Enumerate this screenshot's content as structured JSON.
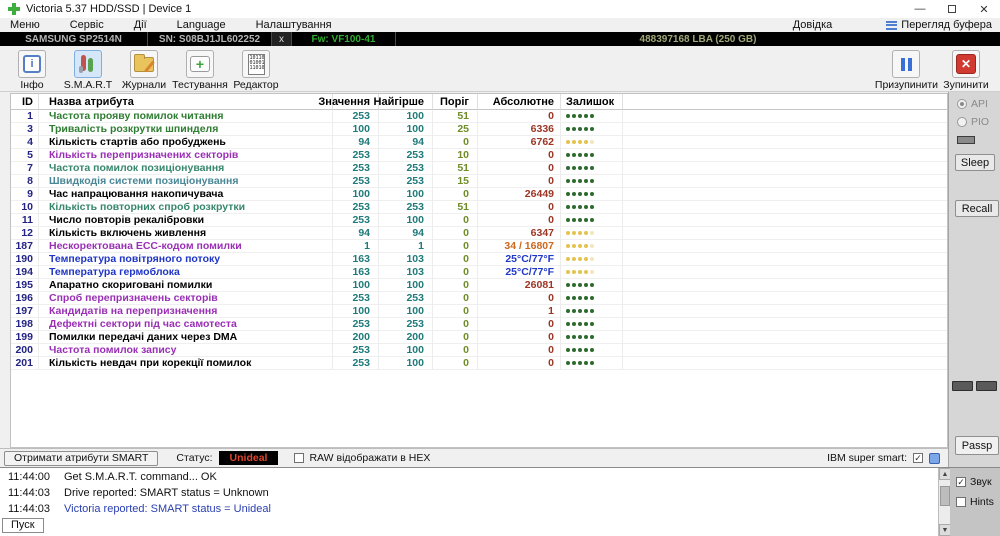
{
  "window": {
    "title": "Victoria 5.37 HDD/SSD | Device 1",
    "minimize": "—",
    "maximize": "",
    "close": "✕"
  },
  "menu": {
    "items": [
      "Меню",
      "Сервіс",
      "Дії",
      "Language",
      "Налаштування"
    ],
    "help": "Довідка",
    "buffer_view": "Перегляд буфера"
  },
  "device": {
    "model": "SAMSUNG SP2514N",
    "sn": "SN: S08BJ1JL602252",
    "close_x": "x",
    "fw": "Fw: VF100-41",
    "lba": "488397168 LBA (250 GB)"
  },
  "toolbar": {
    "buttons": [
      {
        "label": "Інфо"
      },
      {
        "label": "S.M.A.R.T"
      },
      {
        "label": "Журнали"
      },
      {
        "label": "Тестування"
      },
      {
        "label": "Редактор"
      }
    ],
    "pause_label": "Призупинити",
    "stop_label": "Зупинити",
    "editor_icon_bits": "101101 010011 110100"
  },
  "table": {
    "headers": [
      "ID",
      "Назва атрибута",
      "Значення",
      "Найгірше",
      "Поріг",
      "Абсолютне",
      "Залишок"
    ],
    "rows": [
      {
        "id": "1",
        "name": "Частота прояву помилок читання",
        "color": "green",
        "value": "253",
        "worst": "100",
        "threshold": "51",
        "raw": "0",
        "raw_color": "maroon",
        "health": "green"
      },
      {
        "id": "3",
        "name": "Тривалість розкрутки шпинделя",
        "color": "green",
        "value": "100",
        "worst": "100",
        "threshold": "25",
        "raw": "6336",
        "raw_color": "maroon",
        "health": "green"
      },
      {
        "id": "4",
        "name": "Кількість стартів або пробуджень",
        "color": "black",
        "value": "94",
        "worst": "94",
        "threshold": "0",
        "raw": "6762",
        "raw_color": "maroon",
        "health": "yellow"
      },
      {
        "id": "5",
        "name": "Кількість перепризначених секторів",
        "color": "purple",
        "value": "253",
        "worst": "253",
        "threshold": "10",
        "raw": "0",
        "raw_color": "maroon",
        "health": "green"
      },
      {
        "id": "7",
        "name": "Частота помилок позиціонування",
        "color": "teal",
        "value": "253",
        "worst": "253",
        "threshold": "51",
        "raw": "0",
        "raw_color": "maroon",
        "health": "green"
      },
      {
        "id": "8",
        "name": "Швидкодія системи позиціонування",
        "color": "tealblue",
        "value": "253",
        "worst": "253",
        "threshold": "15",
        "raw": "0",
        "raw_color": "maroon",
        "health": "green"
      },
      {
        "id": "9",
        "name": "Час напрацювання накопичувача",
        "color": "black",
        "value": "100",
        "worst": "100",
        "threshold": "0",
        "raw": "26449",
        "raw_color": "maroon",
        "health": "green"
      },
      {
        "id": "10",
        "name": "Кількість повторних спроб розкрутки",
        "color": "teal",
        "value": "253",
        "worst": "253",
        "threshold": "51",
        "raw": "0",
        "raw_color": "maroon",
        "health": "green"
      },
      {
        "id": "11",
        "name": "Число повторів рекалібровки",
        "color": "black",
        "value": "253",
        "worst": "100",
        "threshold": "0",
        "raw": "0",
        "raw_color": "maroon",
        "health": "green"
      },
      {
        "id": "12",
        "name": "Кількість включень живлення",
        "color": "black",
        "value": "94",
        "worst": "94",
        "threshold": "0",
        "raw": "6347",
        "raw_color": "maroon",
        "health": "yellow"
      },
      {
        "id": "187",
        "name": "Нескоректована ECC-кодом помилки",
        "color": "purple",
        "value": "1",
        "worst": "1",
        "threshold": "0",
        "raw": "34 / 16807",
        "raw_color": "orange",
        "health": "yellow"
      },
      {
        "id": "190",
        "name": "Температура повітряного потоку",
        "color": "blue",
        "value": "163",
        "worst": "103",
        "threshold": "0",
        "raw": "25°C/77°F",
        "raw_color": "blue",
        "health": "yellow"
      },
      {
        "id": "194",
        "name": "Температура гермоблока",
        "color": "blue",
        "value": "163",
        "worst": "103",
        "threshold": "0",
        "raw": "25°C/77°F",
        "raw_color": "blue",
        "health": "yellow"
      },
      {
        "id": "195",
        "name": "Апаратно скориговані помилки",
        "color": "black",
        "value": "100",
        "worst": "100",
        "threshold": "0",
        "raw": "26081",
        "raw_color": "maroon",
        "health": "green"
      },
      {
        "id": "196",
        "name": "Спроб перепризначень секторів",
        "color": "purple",
        "value": "253",
        "worst": "253",
        "threshold": "0",
        "raw": "0",
        "raw_color": "maroon",
        "health": "green"
      },
      {
        "id": "197",
        "name": "Кандидатів на перепризначення",
        "color": "purple",
        "value": "100",
        "worst": "100",
        "threshold": "0",
        "raw": "1",
        "raw_color": "maroon",
        "health": "green"
      },
      {
        "id": "198",
        "name": "Дефектні сектори під час самотеста",
        "color": "purple",
        "value": "253",
        "worst": "253",
        "threshold": "0",
        "raw": "0",
        "raw_color": "maroon",
        "health": "green"
      },
      {
        "id": "199",
        "name": "Помилки передачі даних через DMA",
        "color": "black",
        "value": "200",
        "worst": "200",
        "threshold": "0",
        "raw": "0",
        "raw_color": "maroon",
        "health": "green"
      },
      {
        "id": "200",
        "name": "Частота помилок запису",
        "color": "purple",
        "value": "253",
        "worst": "100",
        "threshold": "0",
        "raw": "0",
        "raw_color": "maroon",
        "health": "green"
      },
      {
        "id": "201",
        "name": "Кількість невдач при корекції помилок",
        "color": "black",
        "value": "253",
        "worst": "100",
        "threshold": "0",
        "raw": "0",
        "raw_color": "maroon",
        "health": "green"
      }
    ]
  },
  "status": {
    "get_button": "Отримати атрибути SMART",
    "status_label": "Статус:",
    "status_value": "Unideal",
    "status_value_color": "#e0442c",
    "raw_hex_label": "RAW відображати в HEX",
    "ibm_label": "IBM super smart:"
  },
  "side_panel": {
    "api_label": "API",
    "pio_label": "PIO",
    "sleep_label": "Sleep",
    "recall_label": "Recall",
    "passp_label": "Passp"
  },
  "log": {
    "entries": [
      {
        "time": "11:44:00",
        "text": "Get S.M.A.R.T. command... OK",
        "color": "black"
      },
      {
        "time": "11:44:03",
        "text": "Drive reported: SMART status = Unknown",
        "color": "black"
      },
      {
        "time": "11:44:03",
        "text": "Victoria reported: SMART status = Unideal",
        "color": "blue"
      }
    ],
    "start_label": "Пуск"
  },
  "log_panel": {
    "sound_label": "Звук",
    "hints_label": "Hints"
  },
  "colors": {
    "health_green": "#2e6b2e",
    "health_yellow": "#e5c34f",
    "fw_green": "#2fae2f",
    "value_teal": "#1f7a7a",
    "threshold_olive": "#6f8c28",
    "raw_maroon": "#9c3524"
  }
}
